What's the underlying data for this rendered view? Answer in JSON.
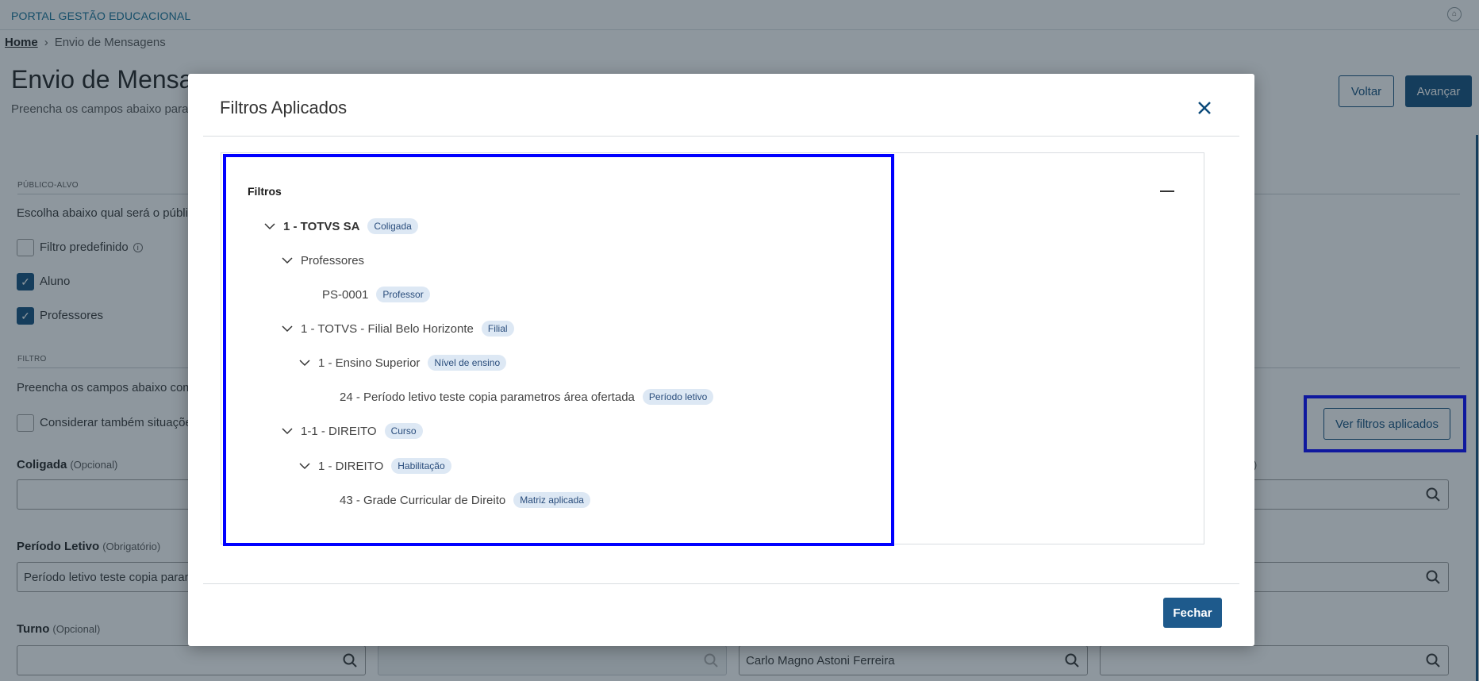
{
  "app": {
    "portal_title": "PORTAL GESTÃO EDUCACIONAL"
  },
  "breadcrumb": {
    "home": "Home",
    "separator": "›",
    "current": "Envio de Mensagens"
  },
  "page": {
    "title": "Envio de Mensage",
    "subtitle": "Preencha os campos abaixo para p",
    "voltar_label": "Voltar",
    "avancar_label": "Avançar"
  },
  "publico_alvo": {
    "section_label": "PÚBLICO-ALVO",
    "instruction": "Escolha abaixo qual será o público",
    "options": [
      {
        "label": "Filtro predefinido",
        "checked": false
      },
      {
        "label": "Aluno",
        "checked": true
      },
      {
        "label": "Professores",
        "checked": true
      }
    ]
  },
  "filtro": {
    "section_label": "FILTRO",
    "instruction": "Preencha os campos abaixo com o",
    "considerar_label": "Considerar também situações",
    "ver_filtros_label": "Ver filtros aplicados",
    "fields": {
      "coligada_label": "Coligada",
      "coligada_opt": "(Opcional)",
      "periodo_label": "Período Letivo",
      "periodo_opt": "(Obrigatório)",
      "periodo_value": "Período letivo teste copia parame",
      "turno_label": "Turno",
      "turno_opt": "(Opcional)",
      "right_partial_opt": "l)",
      "professor_value": "Carlo Magno Astoni Ferreira"
    }
  },
  "modal": {
    "title": "Filtros Aplicados",
    "close_glyph": "✕",
    "fechar_label": "Fechar",
    "tree_header": "Filtros",
    "nodes": [
      {
        "label": "1 - TOTVS SA",
        "tag": "Coligada",
        "bold": true
      },
      {
        "label": "Professores",
        "tag": ""
      },
      {
        "label": "PS-0001",
        "tag": "Professor"
      },
      {
        "label": "1 - TOTVS - Filial Belo Horizonte",
        "tag": "Filial"
      },
      {
        "label": "1 - Ensino Superior",
        "tag": "Nível de ensino"
      },
      {
        "label": "24 - Período letivo teste copia parametros área ofertada",
        "tag": "Período letivo"
      },
      {
        "label": "1-1 - DIREITO",
        "tag": "Curso"
      },
      {
        "label": "1 - DIREITO",
        "tag": "Habilitação"
      },
      {
        "label": "43 - Grade Curricular de Direito",
        "tag": "Matriz aplicada"
      }
    ]
  },
  "colors": {
    "accent": "#0c4a7a",
    "overlay": "#1d2f3d",
    "tag_bg": "#dde8f4",
    "focus_outline": "#0000ff"
  }
}
